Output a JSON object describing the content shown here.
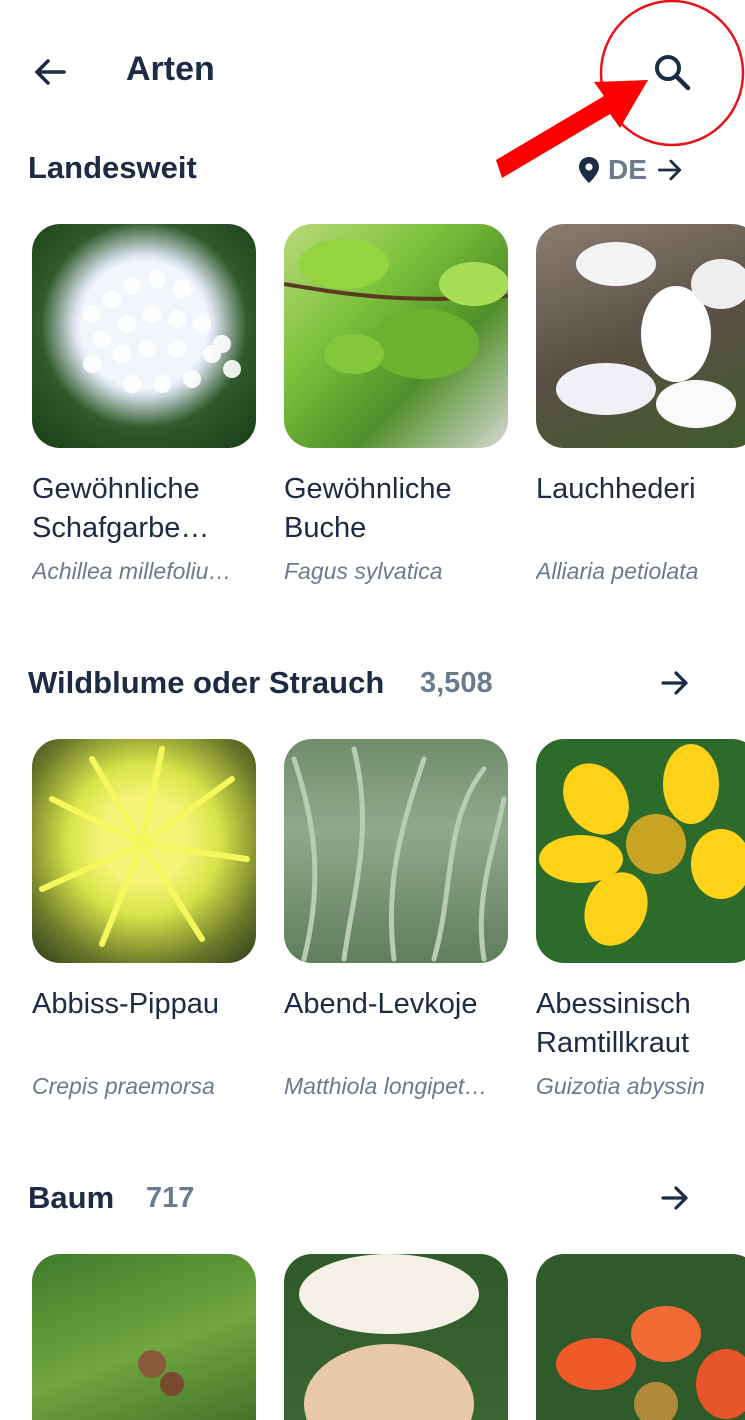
{
  "header": {
    "title": "Arten"
  },
  "sections": [
    {
      "title": "Landesweit",
      "location": "DE",
      "items": [
        {
          "name": "Gewöhnliche\nSchafgarbe…",
          "scientific": "Achillea millefoliu…"
        },
        {
          "name": "Gewöhnliche\nBuche",
          "scientific": "Fagus sylvatica"
        },
        {
          "name": "Lauchhederi",
          "scientific": "Alliaria petiolata"
        }
      ]
    },
    {
      "title": "Wildblume oder Strauch",
      "count": "3,508",
      "items": [
        {
          "name": "Abbiss-Pippau",
          "scientific": "Crepis praemorsa"
        },
        {
          "name": "Abend-Levkoje",
          "scientific": "Matthiola longipet…"
        },
        {
          "name": "Abessinisch\nRamtillkraut",
          "scientific": "Guizotia abyssin"
        }
      ]
    },
    {
      "title": "Baum",
      "count": "717",
      "items": [
        {},
        {},
        {}
      ]
    }
  ],
  "colors": {
    "text": "#1d2b44",
    "muted": "#6b7a8d",
    "annotation": "#e8131b"
  },
  "icons": [
    "back-arrow-icon",
    "search-icon",
    "location-pin-icon",
    "arrow-right-icon"
  ]
}
